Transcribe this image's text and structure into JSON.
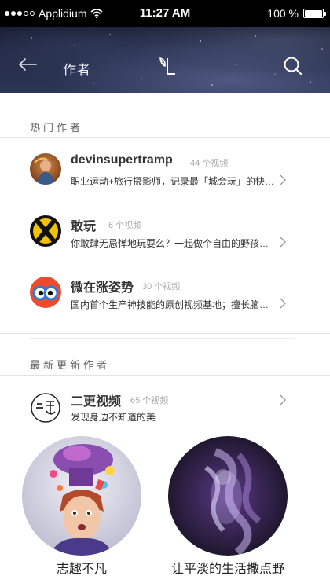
{
  "status_bar": {
    "carrier": "Applidium",
    "time": "11:27 AM",
    "battery": "100 %",
    "battery_level": 1.0
  },
  "nav": {
    "title": "作者",
    "back_icon": "back-arrow-icon",
    "logo_icon": "leaf-l-logo-icon",
    "search_icon": "search-icon"
  },
  "hot_authors": {
    "title": "热门作者",
    "items": [
      {
        "name": "devinsupertramp",
        "count": "44 个视频",
        "desc": "职业运动+旅行摄影师，记录最「城会玩」的快…"
      },
      {
        "name": "敢玩",
        "count": "6 个视频",
        "desc": "你敢肆无忌惮地玩耍么？一起做个自由的野孩…"
      },
      {
        "name": "微在涨姿势",
        "count": "30 个视频",
        "desc": "国内首个生产神技能的原创视频基地；擅长脑…"
      }
    ]
  },
  "latest_authors": {
    "title": "最新更新作者",
    "items": [
      {
        "name": "二更视频",
        "count": "65 个视频",
        "desc": "发现身边不知道的美"
      }
    ],
    "cards": [
      {
        "label": "志趣不凡"
      },
      {
        "label": "让平淡的生活撒点野"
      }
    ]
  }
}
